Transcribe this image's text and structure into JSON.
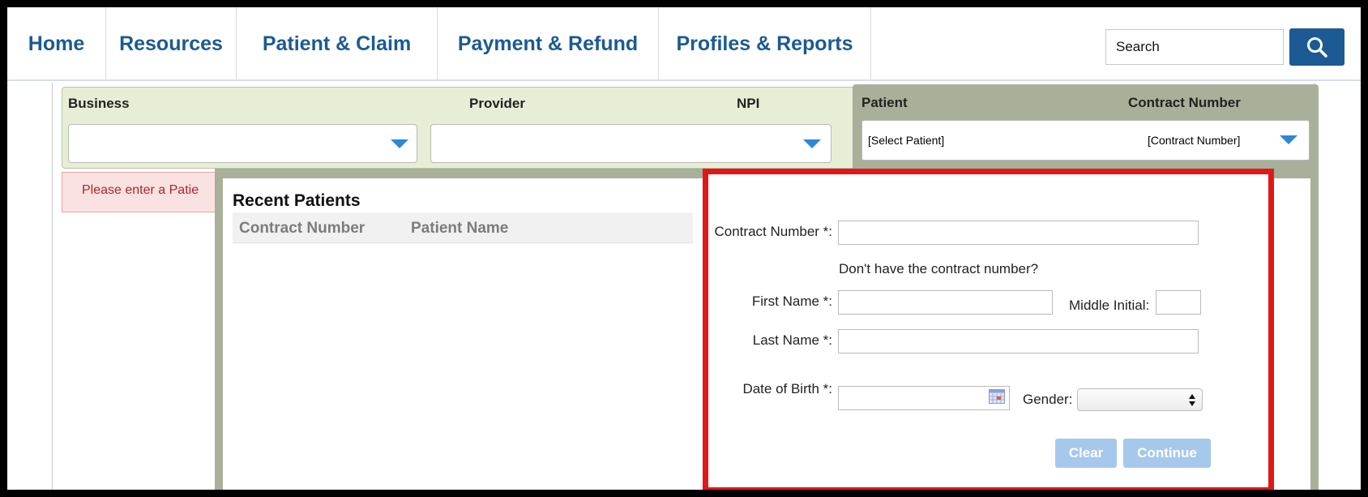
{
  "nav": {
    "items": [
      {
        "label": "Home"
      },
      {
        "label": "Resources"
      },
      {
        "label": "Patient & Claim"
      },
      {
        "label": "Payment & Refund"
      },
      {
        "label": "Profiles & Reports"
      }
    ],
    "search_placeholder": "Search"
  },
  "selector": {
    "business_label": "Business",
    "provider_label": "Provider",
    "npi_label": "NPI",
    "patient_label": "Patient",
    "contract_label": "Contract Number",
    "patient_value": "[Select Patient]",
    "contract_value": "[Contract Number]"
  },
  "error": {
    "message": "Please enter a Patie"
  },
  "recent": {
    "title": "Recent Patients",
    "columns": [
      "Contract Number",
      "Patient Name"
    ]
  },
  "form": {
    "contract_label": "Contract Number *:",
    "hint": "Don't have the contract number?",
    "first_name_label": "First Name *:",
    "middle_initial_label": "Middle Initial:",
    "last_name_label": "Last Name *:",
    "dob_label": "Date of Birth *:",
    "gender_label": "Gender:",
    "clear_label": "Clear",
    "continue_label": "Continue"
  },
  "colors": {
    "nav_text": "#1b5a93",
    "selector_bg": "#e6efd5",
    "panel_bg": "#a8b099",
    "highlight": "#e01818",
    "button_disabled": "#a6c8ea"
  }
}
